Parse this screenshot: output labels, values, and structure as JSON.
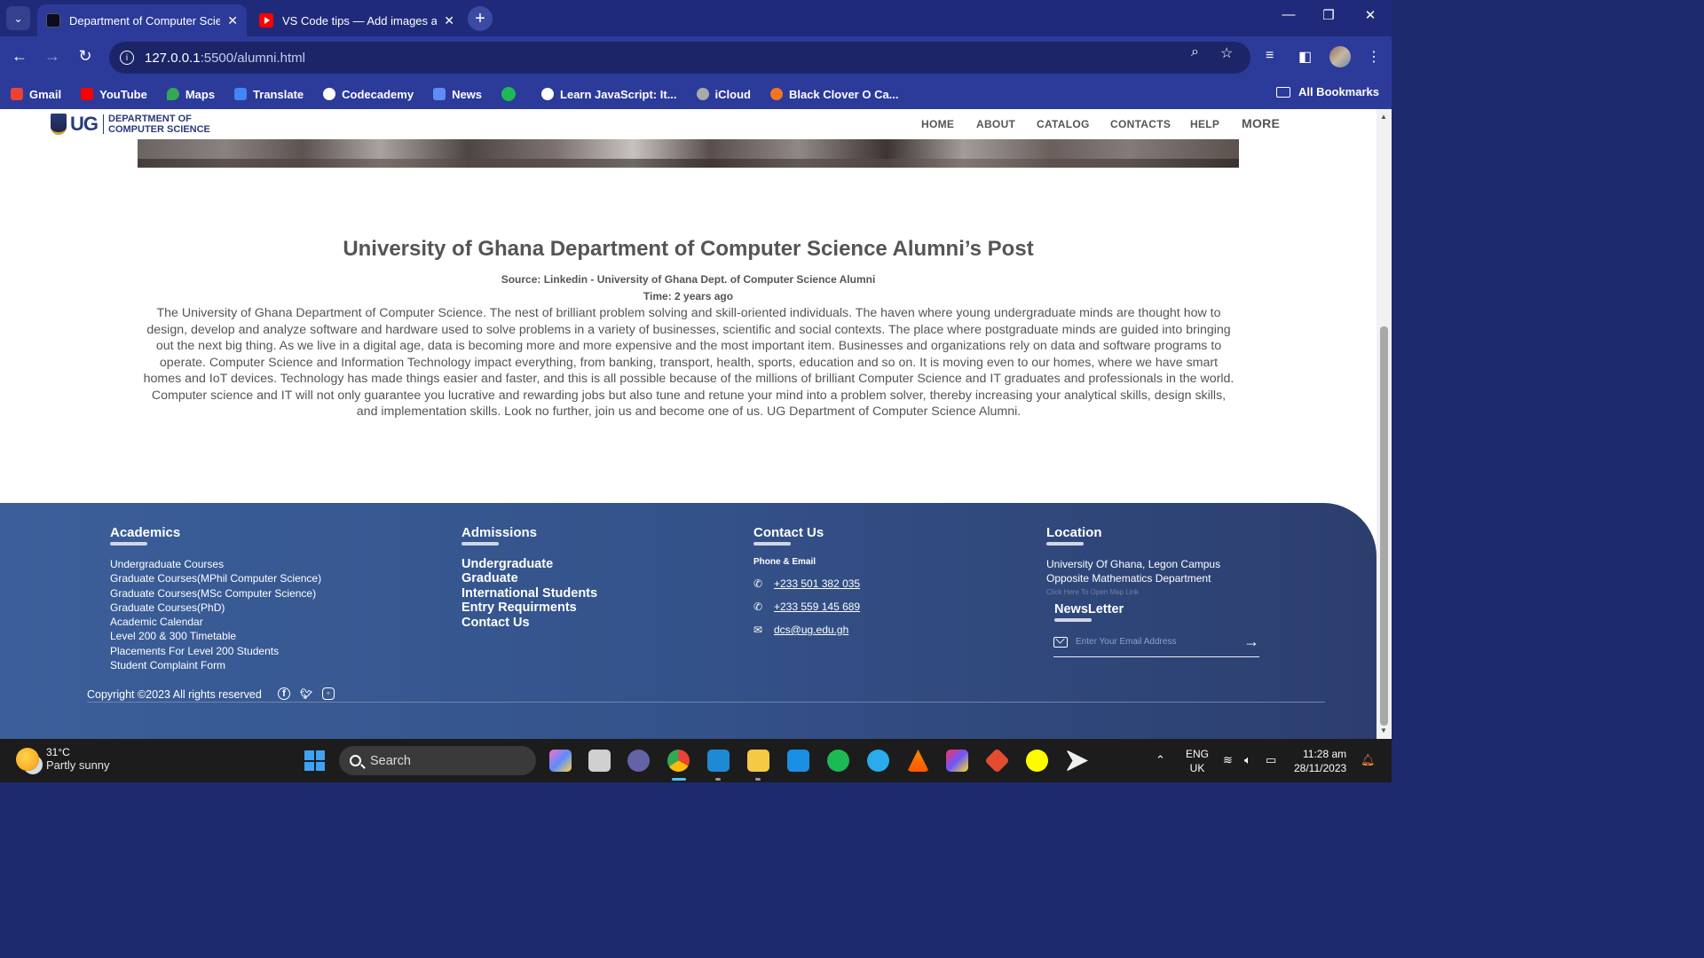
{
  "browser": {
    "tabs": [
      {
        "title": "Department of Computer Science",
        "active": true
      },
      {
        "title": "VS Code tips — Add images and more",
        "active": false
      }
    ],
    "url_host": "127.0.0.1",
    "url_path": ":5500/alumni.html",
    "bookmarks": [
      {
        "label": "Gmail",
        "icon": "gmail-icon",
        "color": "#ea4335"
      },
      {
        "label": "YouTube",
        "icon": "youtube-icon",
        "color": "#ff0000"
      },
      {
        "label": "Maps",
        "icon": "maps-icon",
        "color": "#34a853"
      },
      {
        "label": "Translate",
        "icon": "translate-icon",
        "color": "#4285f4"
      },
      {
        "label": "Codecademy",
        "icon": "globe-icon",
        "color": "#ffffff"
      },
      {
        "label": "News",
        "icon": "news-icon",
        "color": "#5f8cf5"
      },
      {
        "label": "",
        "icon": "spotify-icon",
        "color": "#1db954"
      },
      {
        "label": "Learn JavaScript: It...",
        "icon": "globe-icon",
        "color": "#ffffff"
      },
      {
        "label": "iCloud",
        "icon": "apple-icon",
        "color": "#aaaaaa"
      },
      {
        "label": "Black Clover O Ca...",
        "icon": "crunchyroll-icon",
        "color": "#f47521"
      }
    ],
    "all_bookmarks": "All Bookmarks"
  },
  "site": {
    "logo_ug": "UG",
    "logo_dept_line1": "DEPARTMENT OF",
    "logo_dept_line2": "COMPUTER SCIENCE",
    "nav": [
      "HOME",
      "ABOUT",
      "CATALOG",
      "CONTACTS",
      "HELP"
    ],
    "nav_more": "MORE"
  },
  "post": {
    "title": "University of Ghana Department of Computer Science Alumni’s Post",
    "source": "Source: Linkedin - University of Ghana Dept. of Computer Science Alumni",
    "time": "Time: 2 years ago",
    "body": "The University of Ghana Department of Computer Science. The nest of brilliant problem solving and skill-oriented individuals. The haven where young undergraduate minds are thought how to design, develop and analyze software and hardware used to solve problems in a variety of businesses, scientific and social contexts. The place where postgraduate minds are guided into bringing out the next big thing. As we live in a digital age, data is becoming more and more expensive and the most important item. Businesses and organizations rely on data and software programs to operate. Computer Science and Information Technology impact everything, from banking, transport, health, sports, education and so on. It is moving even to our homes, where we have smart homes and IoT devices. Technology has made things easier and faster, and this is all possible because of the millions of brilliant Computer Science and IT graduates and professionals in the world. Computer science and IT will not only guarantee you lucrative and rewarding jobs but also tune and retune your mind into a problem solver, thereby increasing your analytical skills, design skills, and implementation skills. Look no further, join us and become one of us. UG Department of Computer Science Alumni."
  },
  "footer": {
    "academics": {
      "heading": "Academics",
      "links": [
        "Undergraduate Courses",
        "Graduate Courses(MPhil Computer Science)",
        "Graduate Courses(MSc Computer Science)",
        "Graduate Courses(PhD)",
        "Academic Calendar",
        "Level 200 & 300 Timetable",
        "Placements For Level 200 Students",
        "Student Complaint Form"
      ]
    },
    "admissions": {
      "heading": "Admissions",
      "links": [
        "Undergraduate",
        "Graduate",
        "International Students",
        "Entry Requirments",
        "Contact Us"
      ]
    },
    "contact": {
      "heading": "Contact Us",
      "sub": "Phone & Email",
      "phone1": "+233 501 382 035",
      "phone2": "+233 559 145 689",
      "email": "dcs@ug.edu.gh"
    },
    "location": {
      "heading": "Location",
      "line1": "University Of Ghana, Legon Campus",
      "line2": "Opposite Mathematics Department",
      "map_link": "Click Here To Open Map Link"
    },
    "newsletter": {
      "heading": "NewsLetter",
      "placeholder": "Enter Your Email Address"
    },
    "copyright": "Copyright ©2023 All rights reserved"
  },
  "taskbar": {
    "temp": "31°C",
    "weather": "Partly sunny",
    "search": "Search",
    "lang1": "ENG",
    "lang2": "UK",
    "time": "11:28 am",
    "date": "28/11/2023"
  }
}
